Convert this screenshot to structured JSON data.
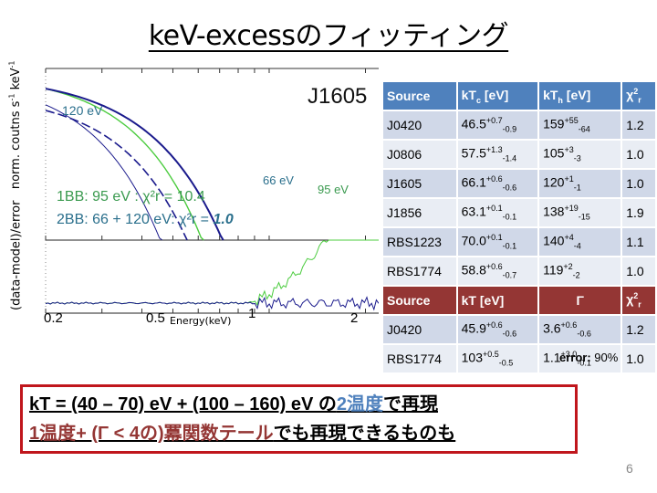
{
  "slide": {
    "title": "keV-excessのフィッティング",
    "page_number": "6"
  },
  "plot": {
    "ylabel_top": "norm. coutns s",
    "ylabel_top_sup1": "-1",
    "ylabel_top_mid": " keV",
    "ylabel_top_sup2": "-1",
    "ylabel_bottom": "(data-model)/error",
    "source_label": "J1605",
    "curve_labels": {
      "hot": "120 eV",
      "cool": "66 eV",
      "single": "95 eV"
    },
    "fit_1bb": "1BB: 95 eV : χ²r = 10.4",
    "fit_2bb_prefix": "2BB: 66 + 120 eV: χ²r = ",
    "fit_2bb_value": "1.0",
    "xticks": [
      "0.2",
      "0.5",
      "1",
      "2"
    ],
    "xlabel": "Energy(keV)",
    "colors": {
      "two_bb": "#1a1a8c",
      "one_bb": "#4ccc3f",
      "label_blue": "#2a6f8c",
      "label_green": "#3a9a4f"
    }
  },
  "table_bb": {
    "headers": [
      "Source",
      "kT",
      "c",
      " [eV]",
      "kT",
      "h",
      " [eV]",
      "χ",
      "2",
      "r"
    ],
    "rows": [
      {
        "source": "J0420",
        "kTc": "46.5",
        "kTc_up": "+0.7",
        "kTc_lo": "-0.9",
        "kTh": "159",
        "kTh_up": "+55",
        "kTh_lo": "-64",
        "chi2": "1.2"
      },
      {
        "source": "J0806",
        "kTc": "57.5",
        "kTc_up": "+1.3",
        "kTc_lo": "-1.4",
        "kTh": "105",
        "kTh_up": "+3",
        "kTh_lo": "-3",
        "chi2": "1.0"
      },
      {
        "source": "J1605",
        "kTc": "66.1",
        "kTc_up": "+0.6",
        "kTc_lo": "-0.6",
        "kTh": "120",
        "kTh_up": "+1",
        "kTh_lo": "-1",
        "chi2": "1.0"
      },
      {
        "source": "J1856",
        "kTc": "63.1",
        "kTc_up": "+0.1",
        "kTc_lo": "-0.1",
        "kTh": "138",
        "kTh_up": "+19",
        "kTh_lo": "-15",
        "chi2": "1.9"
      },
      {
        "source": "RBS1223",
        "kTc": "70.0",
        "kTc_up": "+0.1",
        "kTc_lo": "-0.1",
        "kTh": "140",
        "kTh_up": "+4",
        "kTh_lo": "-4",
        "chi2": "1.1"
      },
      {
        "source": "RBS1774",
        "kTc": "58.8",
        "kTc_up": "+0.6",
        "kTc_lo": "-0.7",
        "kTh": "119",
        "kTh_up": "+2",
        "kTh_lo": "-2",
        "chi2": "1.0"
      }
    ]
  },
  "table_pl": {
    "headers": [
      "Source",
      "kT [eV]",
      "Γ",
      "χ",
      "2",
      "r"
    ],
    "rows": [
      {
        "source": "J0420",
        "kT": "45.9",
        "kT_up": "+0.6",
        "kT_lo": "-0.6",
        "gamma": "3.6",
        "gamma_up": "+0.6",
        "gamma_lo": "-0.6",
        "chi2": "1.2"
      },
      {
        "source": "RBS1774",
        "kT": "103",
        "kT_up": "+0.5",
        "kT_lo": "-0.5",
        "gamma": "1.1",
        "gamma_up": "+3.0",
        "gamma_lo": "-0.1",
        "chi2": "1.0"
      }
    ],
    "colors": {
      "header_blue": "#4f81bd",
      "header_red": "#943634",
      "row_a": "#d0d8e8",
      "row_b": "#e9edf4"
    }
  },
  "error_note": {
    "label": "error:",
    "value": " 90%"
  },
  "summary": {
    "line1_a": "kT = (40 – 70) eV + (100 – 160) eV の",
    "line1_b": "2温度",
    "line1_c": "で再現",
    "line2_a": "1温度+ (Γ < 4の)冪関数テール",
    "line2_b": "でも再現できるものも",
    "border_color": "#c0161c"
  }
}
